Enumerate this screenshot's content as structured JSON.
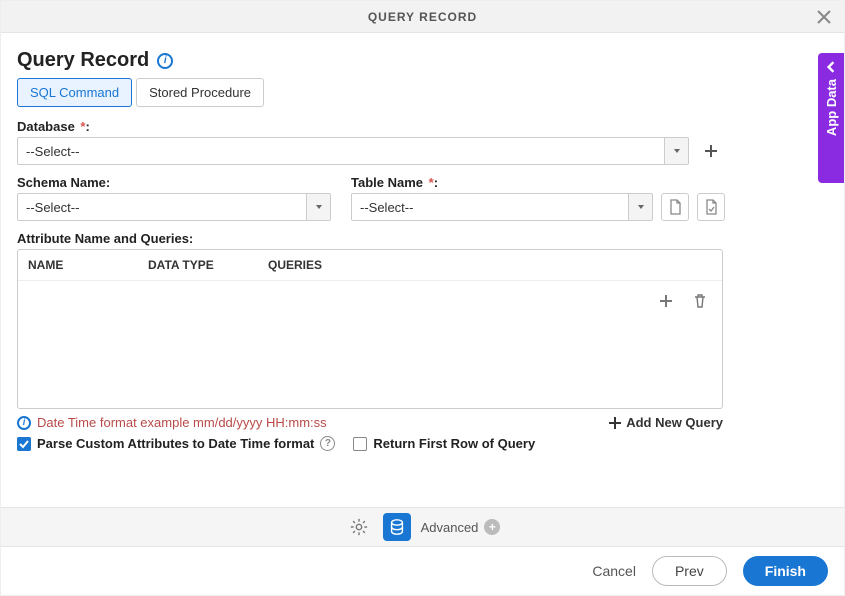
{
  "window": {
    "title": "QUERY RECORD"
  },
  "sidebar": {
    "app_data_label": "App Data"
  },
  "header": {
    "page_title": "Query Record"
  },
  "tabs": {
    "sql_command": "SQL Command",
    "stored_procedure": "Stored Procedure"
  },
  "fields": {
    "database_label": "Database ",
    "database_value": "--Select--",
    "schema_label": "Schema Name:",
    "schema_value": "--Select--",
    "table_label": "Table Name ",
    "table_value": "--Select--",
    "attr_label": "Attribute Name and Queries:"
  },
  "table": {
    "headers": {
      "name": "NAME",
      "data_type": "DATA TYPE",
      "queries": "QUERIES"
    }
  },
  "info_line": {
    "date_time_example": "Date Time format example mm/dd/yyyy HH:mm:ss",
    "add_new_query": "Add New Query"
  },
  "checkboxes": {
    "parse_custom": "Parse Custom Attributes to Date Time format ",
    "return_first_row": "Return First Row of Query"
  },
  "toolbar": {
    "advanced_label": "Advanced "
  },
  "footer": {
    "cancel": "Cancel",
    "prev": "Prev",
    "finish": "Finish"
  },
  "icons": {
    "close": "close-icon",
    "info": "info-icon",
    "plus": "plus-icon",
    "trash": "trash-icon",
    "gear": "gear-icon",
    "db": "database-icon",
    "help": "help-icon",
    "chevron_left": "chevron-left-icon",
    "caret_down": "caret-down-icon",
    "file": "file-icon"
  },
  "colors": {
    "accent": "#1976d2",
    "purple": "#8a2be2",
    "danger_text": "#b94a48"
  }
}
